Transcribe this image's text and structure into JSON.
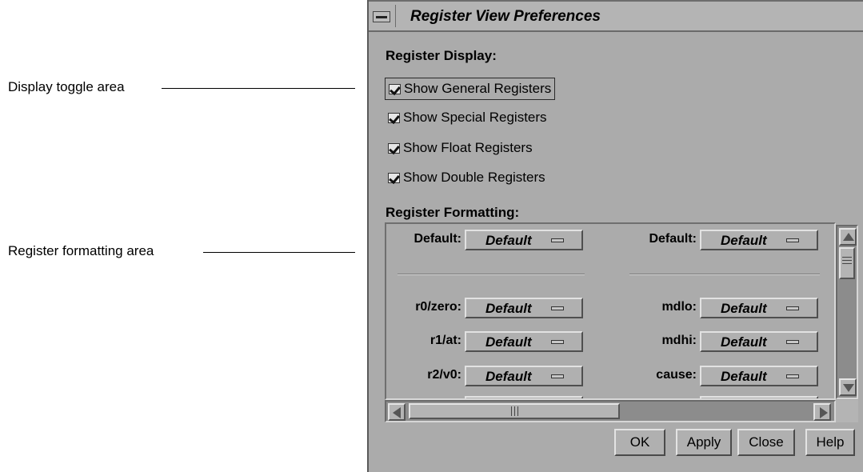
{
  "callouts": {
    "display_toggle": "Display toggle area",
    "register_formatting": "Register formatting area"
  },
  "window": {
    "title": "Register View Preferences"
  },
  "display": {
    "section_title": "Register Display:",
    "checkboxes": [
      {
        "label": "Show General Registers",
        "checked": true,
        "focused": true
      },
      {
        "label": "Show Special Registers",
        "checked": true
      },
      {
        "label": "Show Float Registers",
        "checked": true
      },
      {
        "label": "Show Double Registers",
        "checked": true
      }
    ]
  },
  "formatting": {
    "section_title": "Register Formatting:",
    "rows": [
      {
        "left_label": "Default:",
        "left_value": "Default",
        "right_label": "Default:",
        "right_value": "Default"
      },
      {
        "left_label": "r0/zero:",
        "left_value": "Default",
        "right_label": "mdlo:",
        "right_value": "Default"
      },
      {
        "left_label": "r1/at:",
        "left_value": "Default",
        "right_label": "mdhi:",
        "right_value": "Default"
      },
      {
        "left_label": "r2/v0:",
        "left_value": "Default",
        "right_label": "cause:",
        "right_value": "Default"
      }
    ]
  },
  "buttons": {
    "ok": "OK",
    "apply": "Apply",
    "close": "Close",
    "help": "Help"
  }
}
